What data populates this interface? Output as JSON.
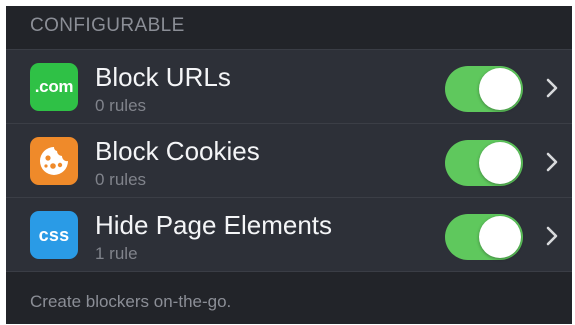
{
  "section": {
    "header": "CONFIGURABLE",
    "footer": "Create blockers on-the-go."
  },
  "rows": [
    {
      "title": "Block URLs",
      "subtitle": "0 rules",
      "icon_name": "dotcom-icon",
      "icon_text": ".com",
      "icon_color": "#2fc146",
      "enabled": true
    },
    {
      "title": "Block Cookies",
      "subtitle": "0 rules",
      "icon_name": "cookie-icon",
      "icon_text": "",
      "icon_color": "#ef8a2a",
      "enabled": true
    },
    {
      "title": "Hide Page Elements",
      "subtitle": "1 rule",
      "icon_name": "css-icon",
      "icon_text": "css",
      "icon_color": "#2a9be6",
      "enabled": true
    }
  ],
  "colors": {
    "toggle_on": "#5fc85d",
    "row_background": "#2d3038",
    "page_background": "#222429"
  }
}
